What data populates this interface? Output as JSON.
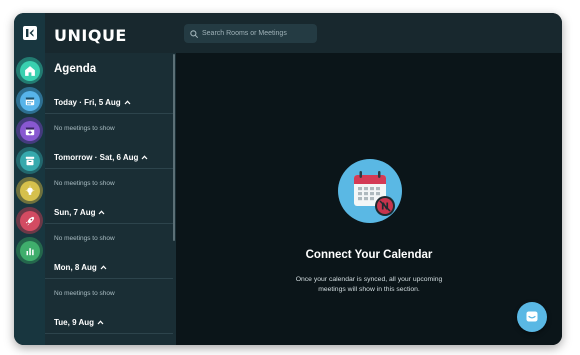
{
  "brand": {
    "name": "UNIQUE"
  },
  "rail": {
    "items": [
      {
        "icon": "home-icon",
        "ring": "#2bb59a",
        "core": "#39d0b0",
        "active": true
      },
      {
        "icon": "calendar-icon",
        "ring": "#3f9fd6",
        "core": "#57b4ea"
      },
      {
        "icon": "calendar-add-icon",
        "ring": "#6a3fb3",
        "core": "#8858d1"
      },
      {
        "icon": "archive-icon",
        "ring": "#2b8f93",
        "core": "#36a9ad"
      },
      {
        "icon": "lightbulb-icon",
        "ring": "#b8a33c",
        "core": "#d6c04c"
      },
      {
        "icon": "rocket-icon",
        "ring": "#b23a4f",
        "core": "#d34b62"
      },
      {
        "icon": "chart-icon",
        "ring": "#2f8f58",
        "core": "#3fae6c"
      }
    ]
  },
  "agenda": {
    "title": "Agenda",
    "days": [
      {
        "label": "Today · Fri, 5 Aug",
        "empty_text": "No meetings to show"
      },
      {
        "label": "Tomorrow · Sat, 6 Aug",
        "empty_text": "No meetings to show"
      },
      {
        "label": "Sun, 7 Aug",
        "empty_text": "No meetings to show"
      },
      {
        "label": "Mon, 8 Aug",
        "empty_text": "No meetings to show"
      },
      {
        "label": "Tue, 9 Aug",
        "empty_text": ""
      }
    ]
  },
  "search": {
    "placeholder": "Search Rooms or Meetings"
  },
  "main": {
    "title": "Connect Your Calendar",
    "description": "Once your calendar is synced, all your upcoming meetings will show in this section."
  },
  "colors": {
    "accent": "#5ab8e4",
    "badge": "#c7344d",
    "calendar_header": "#d33b56"
  }
}
